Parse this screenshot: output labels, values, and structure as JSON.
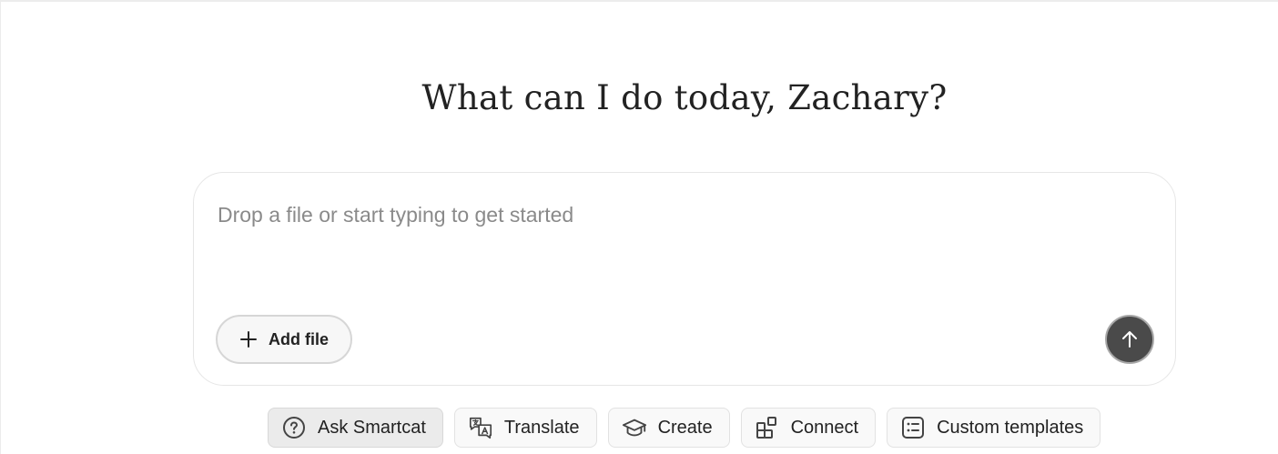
{
  "header": {
    "title": "What can I do today, Zachary?"
  },
  "composer": {
    "placeholder": "Drop a file or start typing to get started",
    "value": "",
    "add_file_label": "Add file",
    "send_icon": "arrow-up-icon"
  },
  "chips": [
    {
      "label": "Ask Smartcat",
      "icon": "question-circle-icon",
      "active": true
    },
    {
      "label": "Translate",
      "icon": "translate-icon",
      "active": false
    },
    {
      "label": "Create",
      "icon": "graduation-cap-icon",
      "active": false
    },
    {
      "label": "Connect",
      "icon": "blocks-icon",
      "active": false
    },
    {
      "label": "Custom templates",
      "icon": "list-template-icon",
      "active": false
    }
  ],
  "colors": {
    "send_button_bg": "#4a4a4a",
    "chip_bg": "#f9f9f9",
    "chip_active_bg": "#ebebeb",
    "text": "#222222",
    "placeholder": "#8a8a8a"
  }
}
